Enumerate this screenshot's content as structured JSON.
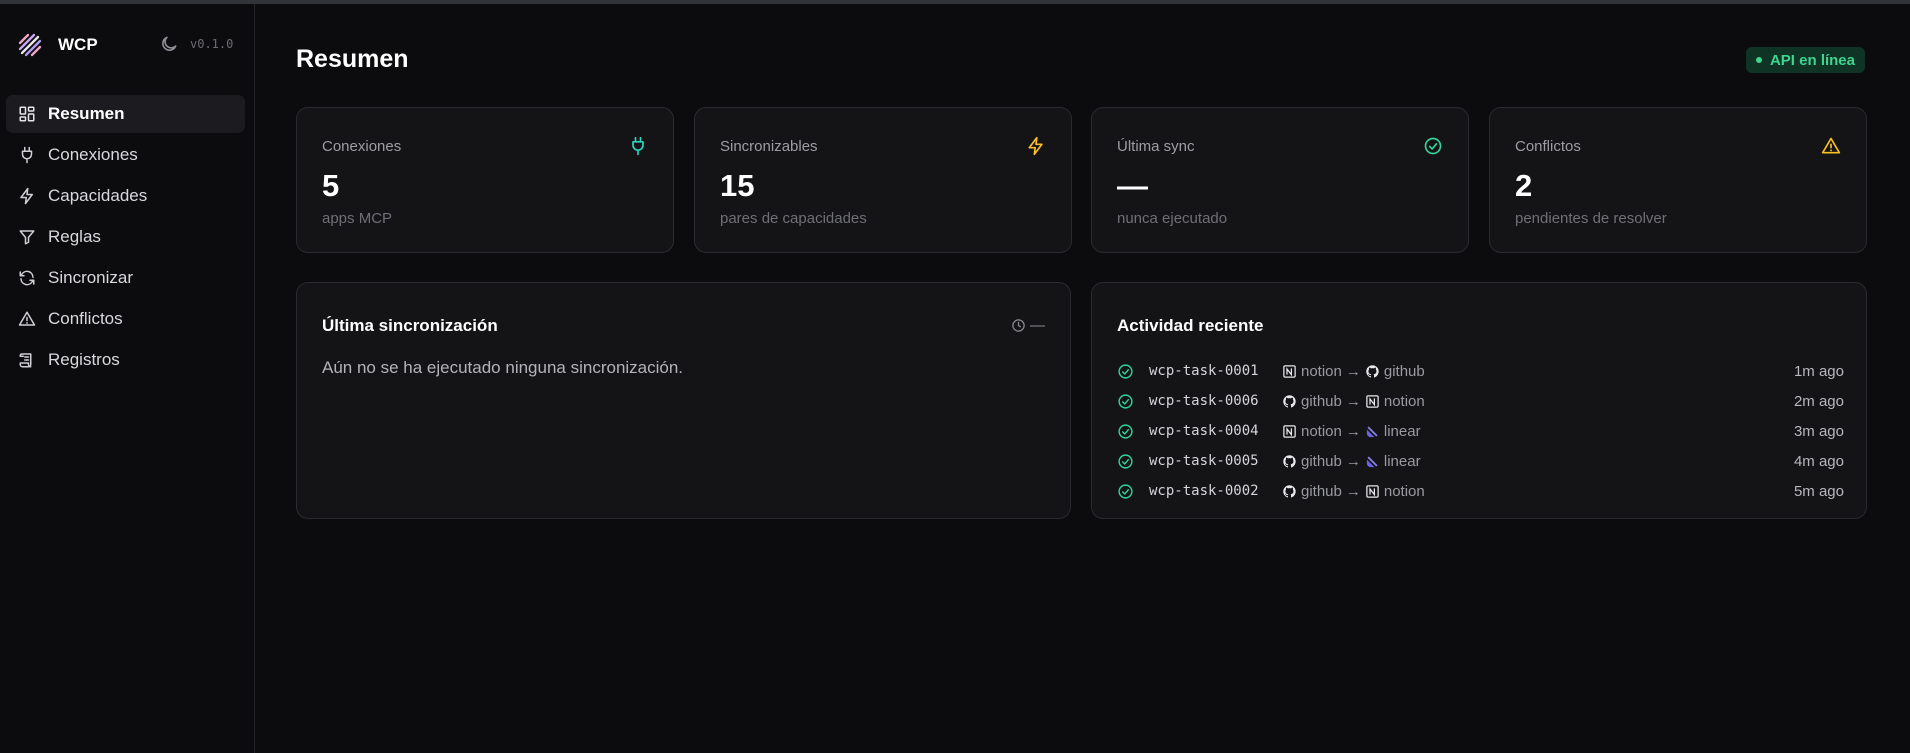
{
  "brand": {
    "name": "WCP",
    "version": "v0.1.0"
  },
  "sidebar": {
    "items": [
      {
        "label": "Resumen",
        "icon": "dashboard-icon",
        "active": true
      },
      {
        "label": "Conexiones",
        "icon": "plug-icon"
      },
      {
        "label": "Capacidades",
        "icon": "lightning-icon"
      },
      {
        "label": "Reglas",
        "icon": "filter-icon"
      },
      {
        "label": "Sincronizar",
        "icon": "refresh-icon"
      },
      {
        "label": "Conflictos",
        "icon": "warning-icon"
      },
      {
        "label": "Registros",
        "icon": "scroll-icon"
      }
    ]
  },
  "header": {
    "title": "Resumen",
    "status_badge": "API en línea"
  },
  "stats": [
    {
      "label": "Conexiones",
      "value": "5",
      "sub": "apps MCP",
      "icon": "plug-icon",
      "color": "#2dd4bf"
    },
    {
      "label": "Sincronizables",
      "value": "15",
      "sub": "pares de capacidades",
      "icon": "lightning-icon",
      "color": "#fbbf24"
    },
    {
      "label": "Última sync",
      "value": "—",
      "sub": "nunca ejecutado",
      "icon": "check-circle-icon",
      "color": "#34d399"
    },
    {
      "label": "Conflictos",
      "value": "2",
      "sub": "pendientes de resolver",
      "icon": "warning-icon",
      "color": "#fbbf24"
    }
  ],
  "last_sync": {
    "title": "Última sincronización",
    "meta": "—",
    "message": "Aún no se ha ejecutado ninguna sincronización."
  },
  "activity": {
    "title": "Actividad reciente",
    "rows": [
      {
        "task": "wcp-task-0001",
        "from": "notion",
        "to": "github",
        "time": "1m ago"
      },
      {
        "task": "wcp-task-0006",
        "from": "github",
        "to": "notion",
        "time": "2m ago"
      },
      {
        "task": "wcp-task-0004",
        "from": "notion",
        "to": "linear",
        "time": "3m ago"
      },
      {
        "task": "wcp-task-0005",
        "from": "github",
        "to": "linear",
        "time": "4m ago"
      },
      {
        "task": "wcp-task-0002",
        "from": "github",
        "to": "notion",
        "time": "5m ago"
      }
    ],
    "arrow": "→"
  },
  "colors": {
    "accent_green": "#3fd48f",
    "linear_purple": "#6d63e6"
  }
}
